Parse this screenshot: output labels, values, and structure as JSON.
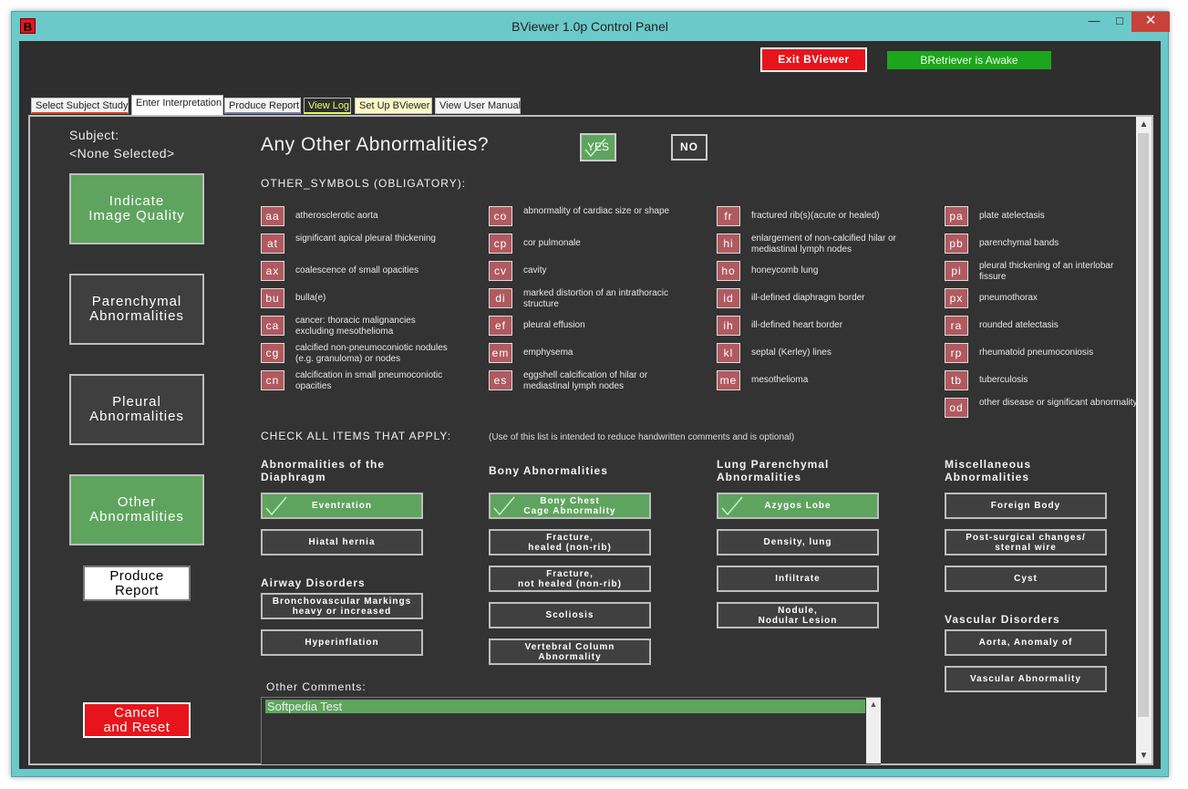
{
  "window": {
    "title": "BViewer 1.0p Control Panel",
    "logo_letter": "B",
    "minimize_glyph": "—",
    "maximize_glyph": "□",
    "close_glyph": "✕"
  },
  "header": {
    "exit_label": "Exit BViewer",
    "status_label": "BRetriever is Awake"
  },
  "tabs": [
    {
      "label": "Select Subject Study"
    },
    {
      "label": "Enter Interpretation"
    },
    {
      "label": "Produce Report"
    },
    {
      "label": "View Log"
    },
    {
      "label": "Set Up BViewer"
    },
    {
      "label": "View User Manual"
    }
  ],
  "sidebar": {
    "subject_label": "Subject:",
    "subject_value": "<None Selected>",
    "buttons": [
      {
        "line1": "Indicate",
        "line2": "Image Quality"
      },
      {
        "line1": "Parenchymal",
        "line2": "Abnormalities"
      },
      {
        "line1": "Pleural",
        "line2": "Abnormalities"
      },
      {
        "line1": "Other",
        "line2": "Abnormalities"
      }
    ],
    "produce": {
      "line1": "Produce",
      "line2": "Report"
    },
    "cancel": {
      "line1": "Cancel",
      "line2": "and Reset"
    }
  },
  "main": {
    "question": "Any Other Abnormalities?",
    "yes_label": "YES",
    "no_label": "NO",
    "symbols_heading": "OTHER_SYMBOLS (OBLIGATORY):",
    "symbol_columns": [
      [
        {
          "code": "aa",
          "desc": "atherosclerotic aorta"
        },
        {
          "code": "at",
          "desc": "significant apical pleural thickening"
        },
        {
          "code": "ax",
          "desc": "coalescence of small opacities"
        },
        {
          "code": "bu",
          "desc": "bulla(e)"
        },
        {
          "code": "ca",
          "desc": "cancer:  thoracic malignancies excluding mesothelioma"
        },
        {
          "code": "cg",
          "desc": "calcified non-pneumoconiotic nodules (e.g. granuloma) or nodes"
        },
        {
          "code": "cn",
          "desc": "calcification in small pneumoconiotic opacities"
        }
      ],
      [
        {
          "code": "co",
          "desc": "abnormality of cardiac size or shape"
        },
        {
          "code": "cp",
          "desc": "cor pulmonale"
        },
        {
          "code": "cv",
          "desc": "cavity"
        },
        {
          "code": "di",
          "desc": "marked distortion of an intrathoracic structure"
        },
        {
          "code": "ef",
          "desc": "pleural effusion"
        },
        {
          "code": "em",
          "desc": "emphysema"
        },
        {
          "code": "es",
          "desc": "eggshell calcification of hilar or mediastinal lymph nodes"
        }
      ],
      [
        {
          "code": "fr",
          "desc": "fractured rib(s)(acute or healed)"
        },
        {
          "code": "hi",
          "desc": "enlargement of non-calcified hilar or mediastinal lymph nodes"
        },
        {
          "code": "ho",
          "desc": "honeycomb lung"
        },
        {
          "code": "id",
          "desc": "ill-defined diaphragm border"
        },
        {
          "code": "ih",
          "desc": "ill-defined heart border"
        },
        {
          "code": "kl",
          "desc": "septal (Kerley) lines"
        },
        {
          "code": "me",
          "desc": "mesothelioma"
        }
      ],
      [
        {
          "code": "pa",
          "desc": "plate atelectasis"
        },
        {
          "code": "pb",
          "desc": "parenchymal bands"
        },
        {
          "code": "pi",
          "desc": "pleural thickening of an interlobar fissure"
        },
        {
          "code": "px",
          "desc": "pneumothorax"
        },
        {
          "code": "ra",
          "desc": "rounded atelectasis"
        },
        {
          "code": "rp",
          "desc": "rheumatoid pneumoconiosis"
        },
        {
          "code": "tb",
          "desc": "tuberculosis"
        },
        {
          "code": "od",
          "desc": "other disease or significant abnormality"
        }
      ]
    ],
    "check_heading": "CHECK ALL ITEMS THAT APPLY:",
    "check_note": "(Use of this list is intended to reduce handwritten comments and is optional)",
    "categories": {
      "diaphragm": {
        "line1": "Abnormalities of the",
        "line2": "Diaphragm"
      },
      "airway": "Airway Disorders",
      "bony": "Bony Abnormalities",
      "lung": {
        "line1": "Lung Parenchymal",
        "line2": "Abnormalities"
      },
      "misc": {
        "line1": "Miscellaneous",
        "line2": "Abnormalities"
      },
      "vascular": "Vascular Disorders"
    },
    "checks": {
      "eventration": {
        "line1": "Eventration",
        "line2": "",
        "checked": true
      },
      "hiatal_hernia": {
        "line1": "Hiatal hernia",
        "line2": "",
        "checked": false
      },
      "bronchovascular": {
        "line1": "Bronchovascular Markings",
        "line2": "heavy or increased",
        "checked": false
      },
      "hyperinflation": {
        "line1": "Hyperinflation",
        "line2": "",
        "checked": false
      },
      "bony_chest": {
        "line1": "Bony Chest",
        "line2": "Cage Abnormality",
        "checked": true
      },
      "fracture_healed": {
        "line1": "Fracture,",
        "line2": "healed (non-rib)",
        "checked": false
      },
      "fracture_not_healed": {
        "line1": "Fracture,",
        "line2": "not healed (non-rib)",
        "checked": false
      },
      "scoliosis": {
        "line1": "Scoliosis",
        "line2": "",
        "checked": false
      },
      "vertebral": {
        "line1": "Vertebral Column",
        "line2": "Abnormality",
        "checked": false
      },
      "azygos": {
        "line1": "Azygos Lobe",
        "line2": "",
        "checked": true
      },
      "density": {
        "line1": "Density, lung",
        "line2": "",
        "checked": false
      },
      "infiltrate": {
        "line1": "Infiltrate",
        "line2": "",
        "checked": false
      },
      "nodule": {
        "line1": "Nodule,",
        "line2": "Nodular Lesion",
        "checked": false
      },
      "foreign_body": {
        "line1": "Foreign Body",
        "line2": "",
        "checked": false
      },
      "post_surgical": {
        "line1": "Post-surgical changes/",
        "line2": "sternal wire",
        "checked": false
      },
      "cyst": {
        "line1": "Cyst",
        "line2": "",
        "checked": false
      },
      "aorta": {
        "line1": "Aorta, Anomaly of",
        "line2": "",
        "checked": false
      },
      "vascular_abn": {
        "line1": "Vascular Abnormality",
        "line2": "",
        "checked": false
      }
    },
    "comments_label": "Other Comments:",
    "comments_value": "Softpedia Test"
  },
  "colors": {
    "accent_green": "#5ea45e",
    "exit_red": "#e8141b",
    "awake_green": "#1ea51e",
    "symbol_rose": "#b05a60"
  }
}
